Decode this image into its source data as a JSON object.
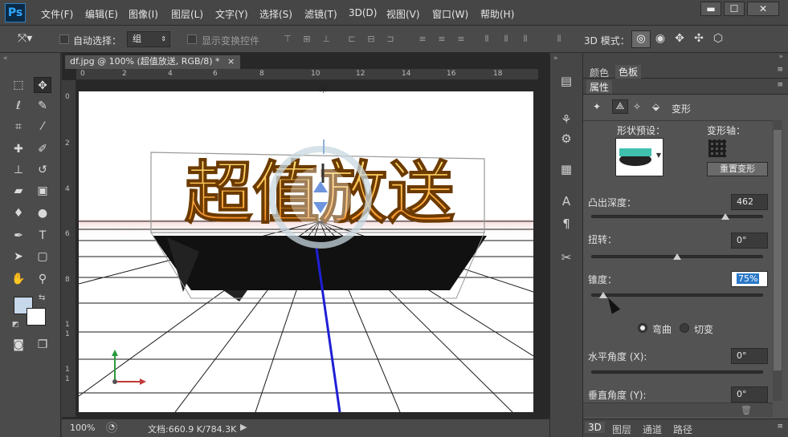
{
  "app": {
    "logo": "Ps"
  },
  "menu": [
    "文件(F)",
    "编辑(E)",
    "图像(I)",
    "图层(L)",
    "文字(Y)",
    "选择(S)",
    "滤镜(T)",
    "3D(D)",
    "视图(V)",
    "窗口(W)",
    "帮助(H)"
  ],
  "window_controls": {
    "minimize": "▬",
    "restore": "☐",
    "close": "✕"
  },
  "options": {
    "auto_select_label": "自动选择：",
    "auto_select_value": "组",
    "show_transform_label": "显示变换控件",
    "mode_3d_label": "3D 模式："
  },
  "document": {
    "tab_title": "df.jpg @ 100% (超值放送, RGB/8) *",
    "tab_close": "×",
    "text_3d": "超值放送",
    "ruler_top": [
      "0",
      "2",
      "4",
      "6",
      "8",
      "10",
      "12",
      "14",
      "16",
      "18"
    ],
    "ruler_left": [
      "0",
      "2",
      "4",
      "6",
      "8",
      "1",
      "1",
      "1",
      "1"
    ],
    "zoom": "100%",
    "doc_info": "文档:660.9 K/784.3K"
  },
  "panel": {
    "top_tabs": [
      "颜色",
      "色板"
    ],
    "title": "属性",
    "deform_tab": "变形",
    "shape_preset_label": "形状预设：",
    "deform_axis_label": "变形轴：",
    "reset_button": "重置变形",
    "extrude_label": "凸出深度：",
    "extrude_value": "462",
    "extrude_level": 0.78,
    "twist_label": "扭转：",
    "twist_value": "0°",
    "twist_level": 0.5,
    "taper_label": "锥度：",
    "taper_value": "75%",
    "taper_level": 0.07,
    "bend_label": "弯曲",
    "shear_label": "切变",
    "bend_selected": true,
    "h_angle_label": "水平角度 (X):",
    "h_angle_value": "0°",
    "v_angle_label": "垂直角度 (Y):",
    "v_angle_value": "0°",
    "bottom_tabs": [
      "3D",
      "图层",
      "通道",
      "路径"
    ]
  },
  "colors": {
    "accent": "#31a8ff",
    "selection": "#2a78c8",
    "axis_blue": "#1f1fd6"
  }
}
